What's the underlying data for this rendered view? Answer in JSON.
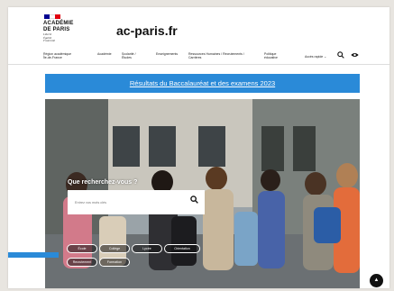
{
  "header": {
    "logo_lines": [
      "ACADÉMIE",
      "DE PARIS"
    ],
    "motto_lines": [
      "Liberté",
      "Égalité",
      "Fraternité"
    ],
    "site_title": "ac-paris.fr"
  },
  "nav": {
    "items": [
      {
        "label": "Région académique Île-de-France"
      },
      {
        "label": "Académie"
      },
      {
        "label": "Scolarité / Études"
      },
      {
        "label": "Enseignements"
      },
      {
        "label": "Ressources Humaines / Recrutements / Carrières"
      },
      {
        "label": "Politique éducative"
      }
    ],
    "acces_rapide": "Accès rapide ⌄"
  },
  "banner": {
    "text": "Résultats du Baccalauréat et des examens 2023"
  },
  "hero": {
    "question": "Que recherchez-vous ?",
    "search_placeholder": "Entrez vos mots clés"
  },
  "quick_links": [
    {
      "label": "École"
    },
    {
      "label": "Collège"
    },
    {
      "label": "Lycée"
    },
    {
      "label": "Orientation"
    },
    {
      "label": "Recrutement"
    },
    {
      "label": "Formation"
    }
  ],
  "colors": {
    "accent": "#2a8ad8",
    "flag_blue": "#000091",
    "flag_red": "#e1000f"
  },
  "icons": {
    "search": "magnifier-icon",
    "accessibility": "eye-icon",
    "back_to_top": "arrow-up-icon"
  }
}
